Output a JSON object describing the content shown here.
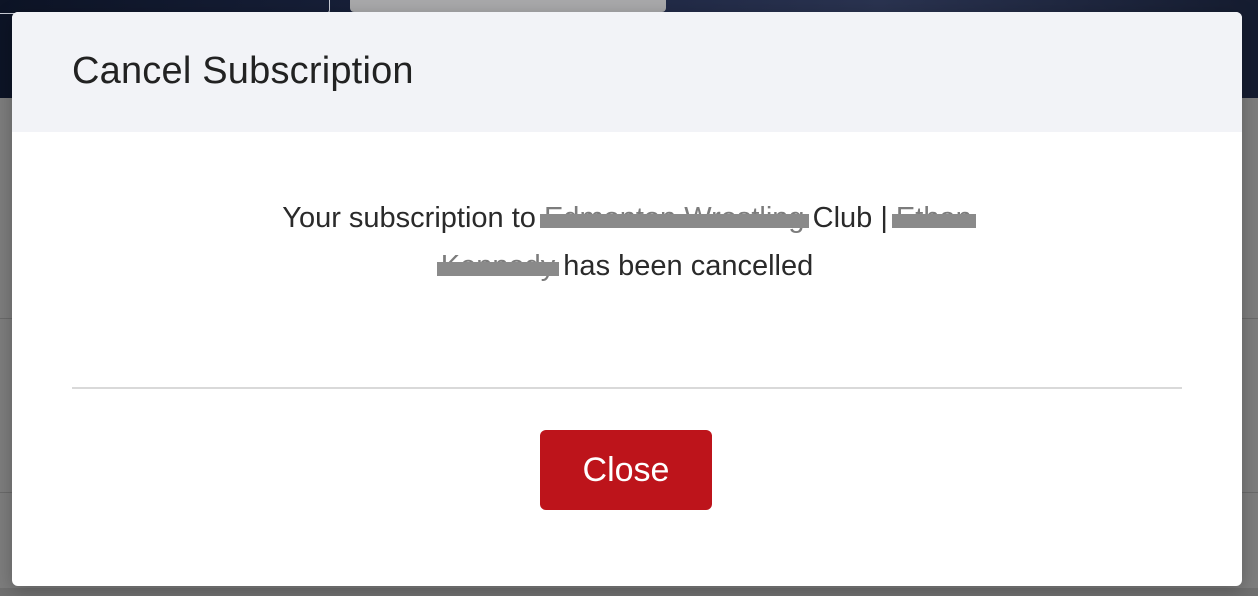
{
  "modal": {
    "title": "Cancel Subscription",
    "message": {
      "prefix": "Your subscription to ",
      "club_name_redacted": "Edmonton Wrestling",
      "club_suffix": " Club | ",
      "first_name_redacted": "Ethan",
      "last_name_redacted": "Kennedy",
      "suffix": " has been cancelled"
    },
    "close_button_label": "Close"
  },
  "colors": {
    "header_bg": "#f2f3f7",
    "primary_button": "#bd141b",
    "overlay": "#7d7d7d",
    "redaction": "#8a8a8a"
  }
}
